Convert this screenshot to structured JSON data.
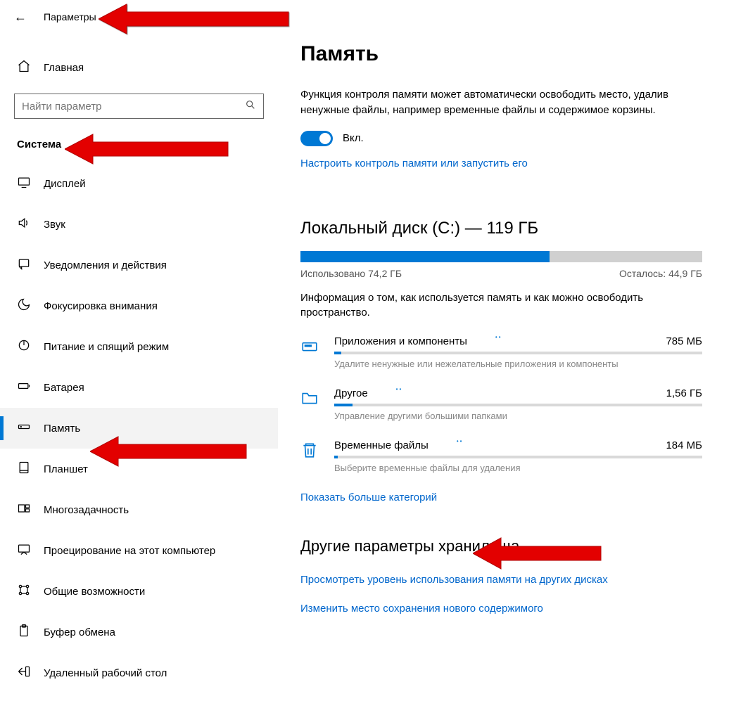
{
  "header": {
    "title": "Параметры"
  },
  "sidebar": {
    "home_label": "Главная",
    "search_placeholder": "Найти параметр",
    "group_label": "Система",
    "items": [
      {
        "label": "Дисплей"
      },
      {
        "label": "Звук"
      },
      {
        "label": "Уведомления и действия"
      },
      {
        "label": "Фокусировка внимания"
      },
      {
        "label": "Питание и спящий режим"
      },
      {
        "label": "Батарея"
      },
      {
        "label": "Память"
      },
      {
        "label": "Планшет"
      },
      {
        "label": "Многозадачность"
      },
      {
        "label": "Проецирование на этот компьютер"
      },
      {
        "label": "Общие возможности"
      },
      {
        "label": "Буфер обмена"
      },
      {
        "label": "Удаленный рабочий стол"
      }
    ],
    "active_index": 6
  },
  "main": {
    "page_title": "Память",
    "intro": "Функция контроля памяти может автоматически освободить место, удалив ненужные файлы, например временные файлы и содержимое корзины.",
    "toggle_label": "Вкл.",
    "configure_link": "Настроить контроль памяти или запустить его",
    "disk": {
      "heading": "Локальный диск (C:) — 119 ГБ",
      "used_label": "Использовано 74,2 ГБ",
      "free_label": "Осталось: 44,9 ГБ",
      "fill_percent": 62,
      "description": "Информация о том, как используется память и как можно освободить пространство."
    },
    "categories": [
      {
        "name": "Приложения и компоненты",
        "size": "785 МБ",
        "fill": 2,
        "sub": "Удалите ненужные или нежелательные приложения и компоненты"
      },
      {
        "name": "Другое",
        "size": "1,56 ГБ",
        "fill": 5,
        "sub": "Управление другими большими папками"
      },
      {
        "name": "Временные файлы",
        "size": "184 МБ",
        "fill": 1,
        "sub": "Выберите временные файлы для удаления"
      }
    ],
    "more_categories_link": "Показать больше категорий",
    "other_heading": "Другие параметры хранилища",
    "other_links": [
      "Просмотреть уровень использования памяти на других дисках",
      "Изменить место сохранения нового содержимого"
    ]
  }
}
